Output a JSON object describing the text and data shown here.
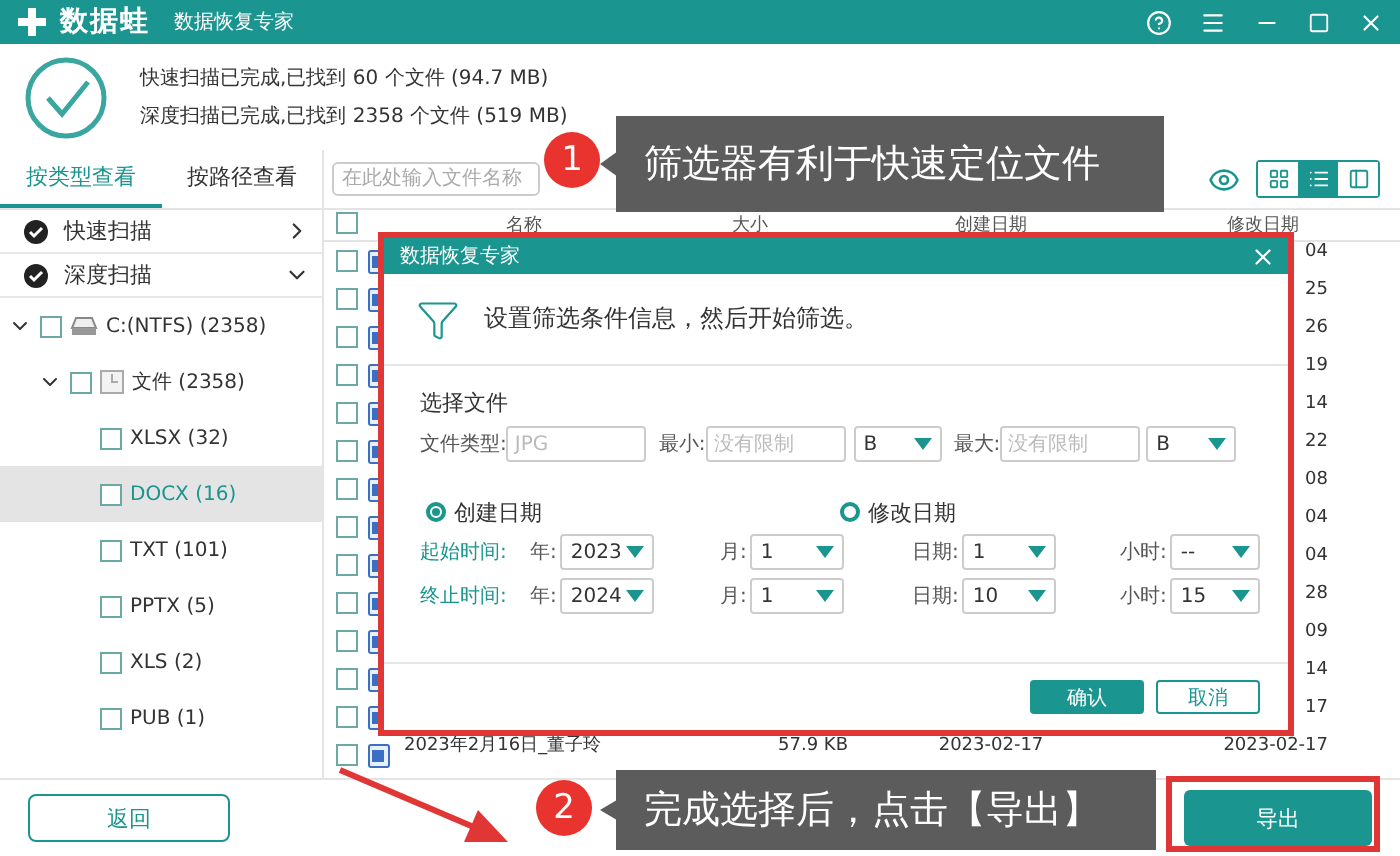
{
  "window": {
    "app_name": "数据蛙",
    "title": "数据恢复专家"
  },
  "scan_summary": [
    "快速扫描已完成,已找到 60 个文件 (94.7 MB)",
    "深度扫描已完成,已找到 2358 个文件 (519 MB)"
  ],
  "view_tabs": [
    {
      "label": "按类型查看",
      "selected": true
    },
    {
      "label": "按路径查看",
      "selected": false
    }
  ],
  "search": {
    "placeholder": "在此处输入文件名称"
  },
  "view_modes": [
    {
      "kind": "grid",
      "selected": false
    },
    {
      "kind": "list",
      "selected": true
    },
    {
      "kind": "panel",
      "selected": false
    }
  ],
  "scans": [
    {
      "label": "快速扫描",
      "expanded": false
    },
    {
      "label": "深度扫描",
      "expanded": true
    }
  ],
  "tree": [
    {
      "label": "C:(NTFS) (2358)",
      "kind": "drive",
      "expanded": true,
      "checked": false,
      "selected": false,
      "children": [
        {
          "label": "文件 (2358)",
          "kind": "folder",
          "expanded": true,
          "checked": false,
          "selected": false,
          "children": [
            {
              "label": "XLSX (32)",
              "checked": false,
              "selected": false
            },
            {
              "label": "DOCX (16)",
              "checked": false,
              "selected": true
            },
            {
              "label": "TXT (101)",
              "checked": false,
              "selected": false
            },
            {
              "label": "PPTX (5)",
              "checked": false,
              "selected": false
            },
            {
              "label": "XLS (2)",
              "checked": false,
              "selected": false
            },
            {
              "label": "PUB (1)",
              "checked": false,
              "selected": false
            }
          ]
        }
      ]
    }
  ],
  "table": {
    "columns": [
      "名称",
      "大小",
      "创建日期",
      "修改日期"
    ],
    "header_checked": false,
    "rows": [
      {
        "checked": false,
        "modified": "04"
      },
      {
        "checked": false,
        "modified": "25"
      },
      {
        "checked": false,
        "modified": "26"
      },
      {
        "checked": false,
        "modified": "19"
      },
      {
        "checked": false,
        "modified": "14"
      },
      {
        "checked": false,
        "modified": "22"
      },
      {
        "checked": false,
        "modified": "08"
      },
      {
        "checked": false,
        "modified": "04"
      },
      {
        "checked": false,
        "modified": "04"
      },
      {
        "checked": false,
        "modified": "28"
      },
      {
        "checked": false,
        "modified": "09"
      },
      {
        "checked": false,
        "modified": "14"
      },
      {
        "checked": false,
        "modified": "17"
      },
      {
        "checked": false,
        "name": "2023年2月16日_董子玲",
        "size": "57.9 KB",
        "created": "2023-02-17",
        "modified": "2023-02-17"
      }
    ]
  },
  "dialog": {
    "title": "数据恢复专家",
    "intro": "设置筛选条件信息，然后开始筛选。",
    "section": "选择文件",
    "file_type": {
      "label": "文件类型:",
      "placeholder": "JPG"
    },
    "min": {
      "label": "最小:",
      "placeholder": "没有限制",
      "unit": "B"
    },
    "max": {
      "label": "最大:",
      "placeholder": "没有限制",
      "unit": "B"
    },
    "date_options": [
      {
        "label": "创建日期",
        "selected": true
      },
      {
        "label": "修改日期",
        "selected": false
      }
    ],
    "ranges": [
      {
        "label": "起始时间:",
        "fields": [
          {
            "label": "年:",
            "value": "2023"
          },
          {
            "label": "月:",
            "value": "1"
          },
          {
            "label": "日期:",
            "value": "1"
          },
          {
            "label": "小时:",
            "value": "--"
          }
        ]
      },
      {
        "label": "终止时间:",
        "fields": [
          {
            "label": "年:",
            "value": "2024"
          },
          {
            "label": "月:",
            "value": "1"
          },
          {
            "label": "日期:",
            "value": "10"
          },
          {
            "label": "小时:",
            "value": "15"
          }
        ]
      }
    ],
    "buttons": [
      "确认",
      "取消"
    ]
  },
  "callouts": [
    {
      "number": "1",
      "text": "筛选器有利于快速定位文件"
    },
    {
      "number": "2",
      "text": "完成选择后，点击【导出】"
    }
  ],
  "back_button": "返回",
  "export_button": "导出"
}
